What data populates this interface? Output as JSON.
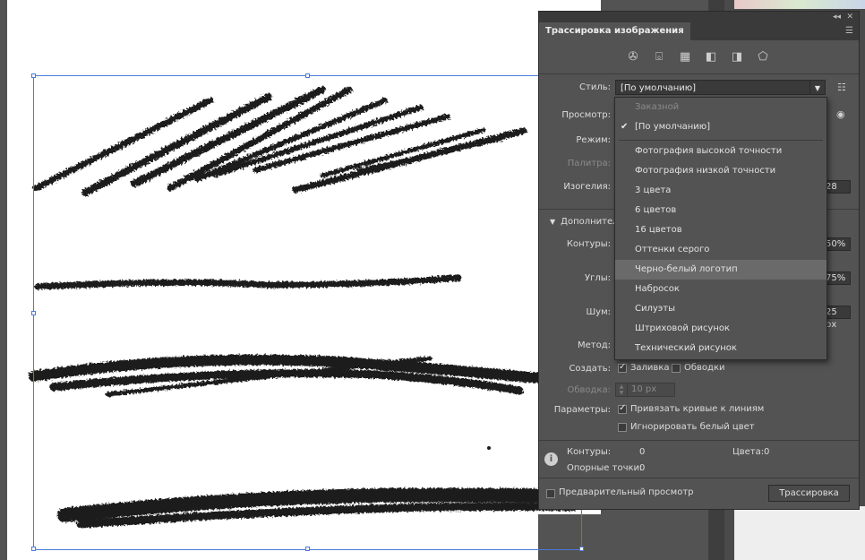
{
  "panel": {
    "title": "Трассировка изображения",
    "collapse_icon": "double-chevron-left-icon",
    "menu_icon": "panel-menu-icon",
    "presets": [
      {
        "name": "auto-color-icon",
        "glyph": "✇"
      },
      {
        "name": "high-color-icon",
        "glyph": "📷"
      },
      {
        "name": "low-color-icon",
        "glyph": "▦"
      },
      {
        "name": "grayscale-icon",
        "glyph": "◧"
      },
      {
        "name": "black-white-icon",
        "glyph": "◨"
      },
      {
        "name": "outline-icon",
        "glyph": "⬠"
      }
    ],
    "style_label": "Стиль:",
    "style_value": "[По умолчанию]",
    "view_label": "Просмотр:",
    "mode_label": "Режим:",
    "palette_label": "Палитра:",
    "threshold_label": "Изогелия:",
    "threshold_value": "28",
    "advanced_label": "Дополнительно",
    "paths_label": "Контуры:",
    "paths_value": "50%",
    "corners_label": "Углы:",
    "corners_value": "75%",
    "noise_label": "Шум:",
    "noise_value": "25 px",
    "method_label": "Метод:",
    "create_label": "Создать:",
    "fill_label": "Заливка",
    "fill_checked": true,
    "strokes_label": "Обводки",
    "strokes_checked": false,
    "stroke_label": "Обводка:",
    "stroke_value": "10 px",
    "options_label": "Параметры:",
    "snap_label": "Привязать кривые к линиям",
    "snap_checked": true,
    "ignore_white_label": "Игнорировать белый цвет",
    "ignore_white_checked": false,
    "info": {
      "paths_label": "Контуры:",
      "paths_value": "0",
      "anchors_label": "Опорные точки:",
      "anchors_value": "0",
      "colors_label": "Цвета:",
      "colors_value": "0"
    },
    "preview_label": "Предварительный просмотр",
    "trace_button": "Трассировка"
  },
  "dropdown": {
    "items": [
      {
        "label": "Заказной",
        "disabled": true
      },
      {
        "label": "[По умолчанию]",
        "checked": true
      },
      {
        "label": "Фотография высокой точности"
      },
      {
        "label": "Фотография низкой точности"
      },
      {
        "label": "3 цвета"
      },
      {
        "label": "6 цветов"
      },
      {
        "label": "16 цветов"
      },
      {
        "label": "Оттенки серого"
      },
      {
        "label": "Черно-белый логотип",
        "hover": true
      },
      {
        "label": "Набросок"
      },
      {
        "label": "Силуэты"
      },
      {
        "label": "Штриховой рисунок"
      },
      {
        "label": "Технический рисунок"
      }
    ]
  },
  "colors": {
    "panel_bg": "#535353",
    "canvas": "#ffffff",
    "selection": "#4a7bd9",
    "ink": "#1a1a1a"
  }
}
